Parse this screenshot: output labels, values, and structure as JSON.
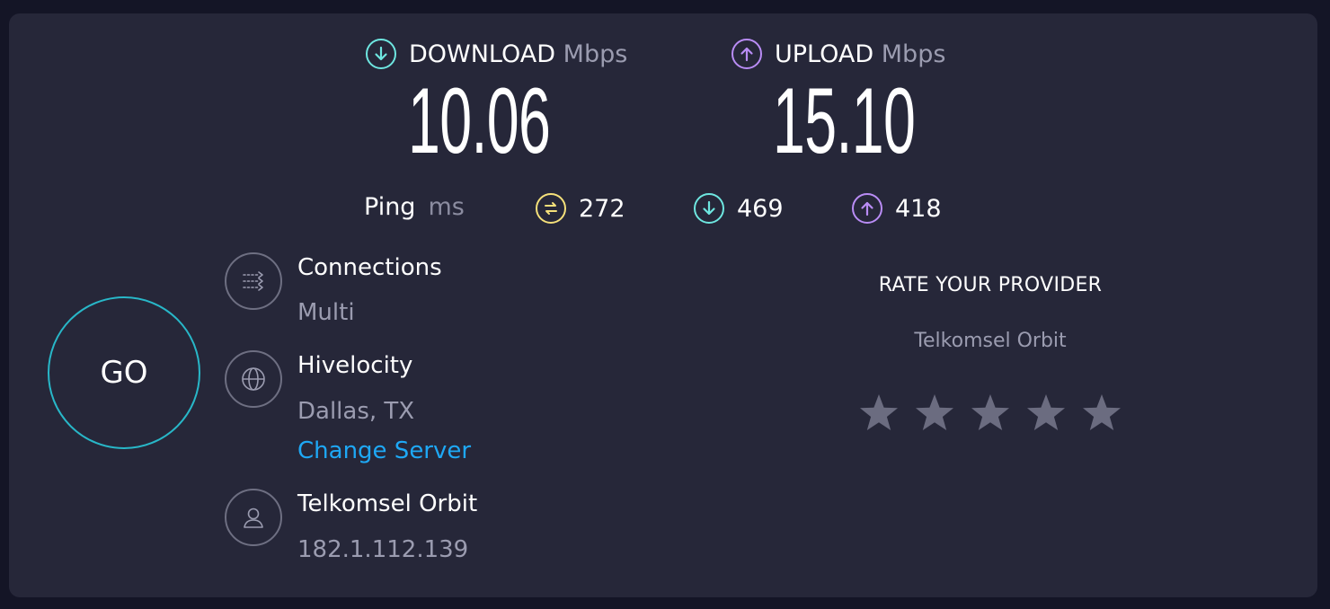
{
  "download": {
    "title": "DOWNLOAD",
    "unit": "Mbps",
    "value": "10.06",
    "icon": "arrow-down-circle-icon",
    "color": "#6ee6e0"
  },
  "upload": {
    "title": "UPLOAD",
    "unit": "Mbps",
    "value": "15.10",
    "icon": "arrow-up-circle-icon",
    "color": "#b98cf5"
  },
  "ping": {
    "label": "Ping",
    "unit": "ms",
    "idle": {
      "value": "272",
      "icon": "ping-idle-icon",
      "color": "#f5e07a"
    },
    "download": {
      "value": "469",
      "icon": "arrow-down-circle-icon",
      "color": "#6ee6e0"
    },
    "upload": {
      "value": "418",
      "icon": "arrow-up-circle-icon",
      "color": "#b98cf5"
    }
  },
  "go_button": {
    "label": "GO",
    "color": "#28b7c8"
  },
  "connections": {
    "title": "Connections",
    "value": "Multi",
    "icon": "connections-arrows-icon"
  },
  "server": {
    "title": "Hivelocity",
    "location": "Dallas, TX",
    "change_label": "Change Server",
    "icon": "globe-icon",
    "link_color": "#1ea8f5"
  },
  "provider": {
    "title": "Telkomsel Orbit",
    "ip": "182.1.112.139",
    "icon": "user-icon"
  },
  "rating": {
    "title": "RATE YOUR PROVIDER",
    "provider_name": "Telkomsel Orbit",
    "stars_total": 5,
    "stars_selected": 0,
    "star_color": "#6b6c80"
  }
}
